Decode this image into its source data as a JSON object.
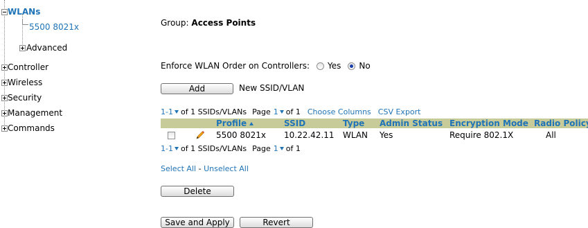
{
  "tree": {
    "wlans_label": "WLANs",
    "wlan_child": "5500 8021x",
    "advanced_label": "Advanced",
    "items": [
      "Controller",
      "Wireless",
      "Security",
      "Management",
      "Commands"
    ]
  },
  "main": {
    "group_prefix": "Group:",
    "group_name": "Access Points",
    "enforce_label": "Enforce WLAN Order on Controllers:",
    "radio_yes": "Yes",
    "radio_no": "No",
    "radio_selected": "No",
    "add_button": "Add",
    "new_ssid_label": "New SSID/VLAN",
    "pager_top": {
      "range": "1-1",
      "of_text": "of 1 SSIDs/VLANs",
      "page_label": "Page",
      "page_num": "1",
      "page_of": "of 1",
      "choose_columns": "Choose Columns",
      "csv_export": "CSV Export"
    },
    "table": {
      "columns": [
        "Profile",
        "SSID",
        "Type",
        "Admin Status",
        "Encryption Mode",
        "Radio Policy"
      ],
      "rows": [
        [
          "5500 8021x",
          "10.22.42.11",
          "WLAN",
          "Yes",
          "Require 802.1X",
          "All"
        ]
      ]
    },
    "pager_bottom": {
      "range": "1-1",
      "of_text": "of 1 SSIDs/VLANs",
      "page_label": "Page",
      "page_num": "1",
      "page_of": "of 1"
    },
    "select_all": "Select All",
    "separator": "-",
    "unselect_all": "Unselect All",
    "delete_button": "Delete",
    "save_apply_button": "Save and Apply",
    "revert_button": "Revert"
  },
  "colors": {
    "link": "#1f73b7",
    "header_bg": "#c6cb99"
  },
  "icons": [
    "tree-expand-icon",
    "tree-collapse-icon",
    "edit-pencil-icon",
    "sort-ascending-icon",
    "dropdown-caret-icon"
  ]
}
